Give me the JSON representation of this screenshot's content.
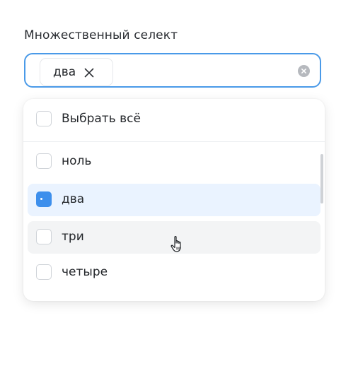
{
  "field": {
    "label": "Множественный селект"
  },
  "selected_chip": {
    "label": "два",
    "remove_icon": "close-icon"
  },
  "clear_icon": "clear-circle-icon",
  "dropdown": {
    "select_all_label": "Выбрать всё",
    "options": [
      {
        "label": "ноль",
        "checked": false,
        "state": "default"
      },
      {
        "label": "два",
        "checked": true,
        "state": "selected"
      },
      {
        "label": "три",
        "checked": false,
        "state": "hovered"
      },
      {
        "label": "четыре",
        "checked": false,
        "state": "default"
      }
    ]
  },
  "colors": {
    "accent": "#4a9ae8",
    "selected_bg": "#eaf3ff",
    "hover_bg": "#f3f4f5",
    "checkbox_checked": "#3d8fec"
  }
}
